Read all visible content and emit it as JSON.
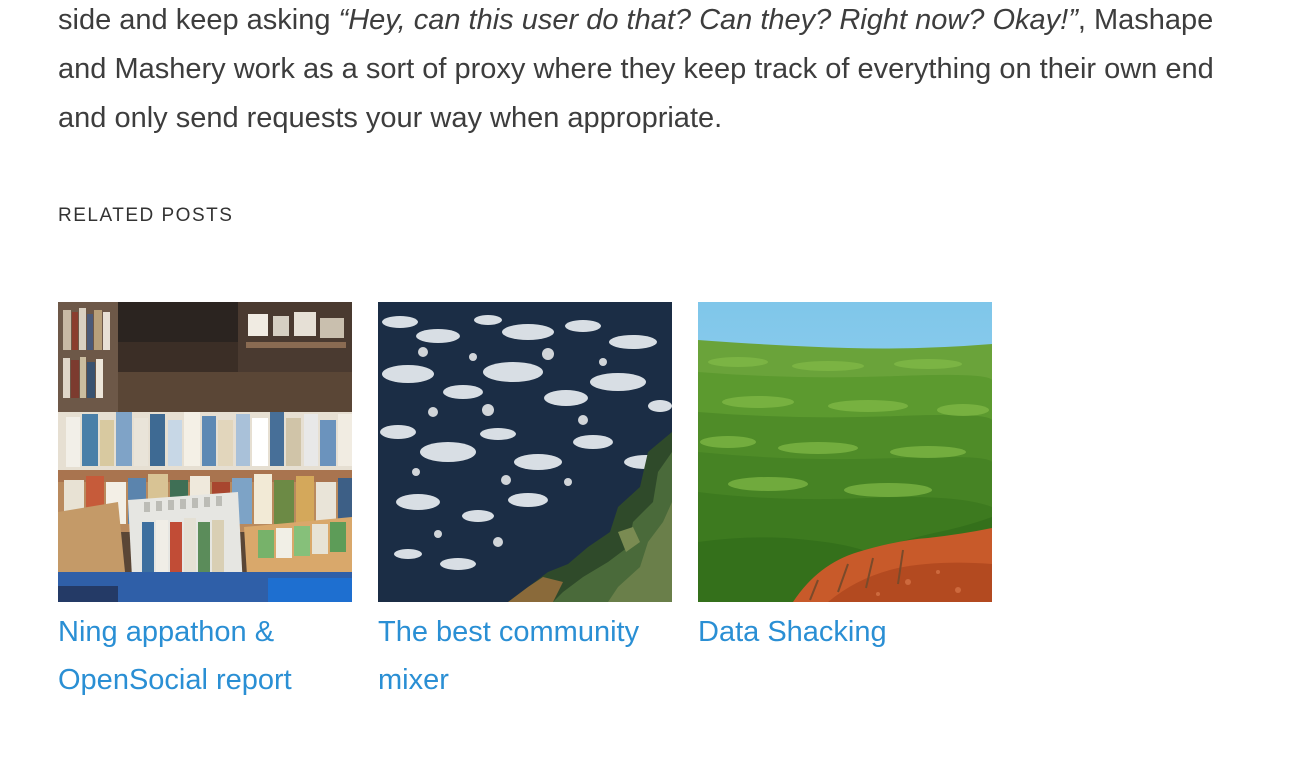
{
  "article": {
    "before_quote": "side and keep asking ",
    "quote": "“Hey, can this user do that? Can they? Right now? Okay!”",
    "after_quote": ", Mashape and Mashery work as a sort of proxy where they keep track of everything on their own end and only send requests your way when appropriate."
  },
  "related": {
    "heading": "RELATED POSTS",
    "posts": [
      {
        "title": "Ning appathon & OpenSocial report",
        "image": "bookshop-image"
      },
      {
        "title": "The best community mixer",
        "image": "satellite-coast-image"
      },
      {
        "title": "Data Shacking",
        "image": "tea-field-image"
      }
    ]
  },
  "colors": {
    "link": "#2a8fd4",
    "text": "#3d3d3d"
  }
}
